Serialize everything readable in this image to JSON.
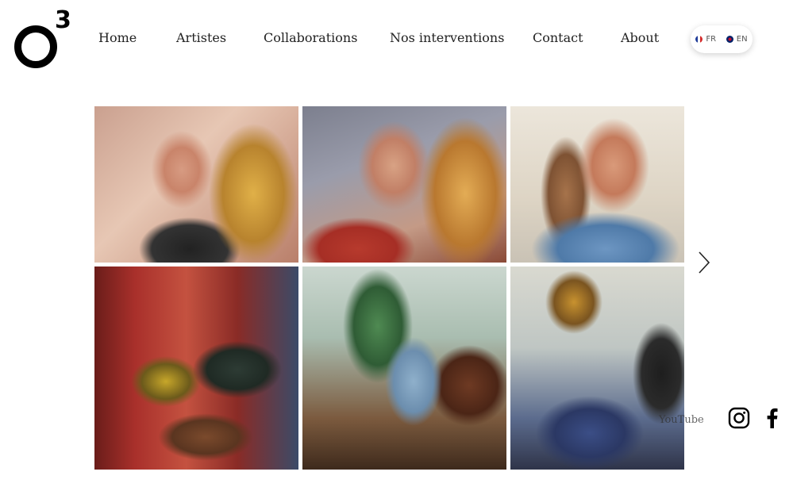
{
  "logo": {
    "letter": "O",
    "superscript": "3"
  },
  "nav": {
    "items": [
      {
        "label": "Home"
      },
      {
        "label": "Artistes"
      },
      {
        "label": "Collaborations"
      },
      {
        "label": "Nos interventions"
      },
      {
        "label": "Contact"
      },
      {
        "label": "About"
      }
    ]
  },
  "language": {
    "options": [
      {
        "code": "FR",
        "flag": "french-flag-icon"
      },
      {
        "code": "EN",
        "flag": "uk-flag-icon"
      }
    ]
  },
  "gallery": {
    "next_icon": "chevron-right-icon"
  },
  "social": {
    "youtube_label": "YouTube",
    "icons": [
      "instagram-icon",
      "facebook-icon"
    ]
  }
}
